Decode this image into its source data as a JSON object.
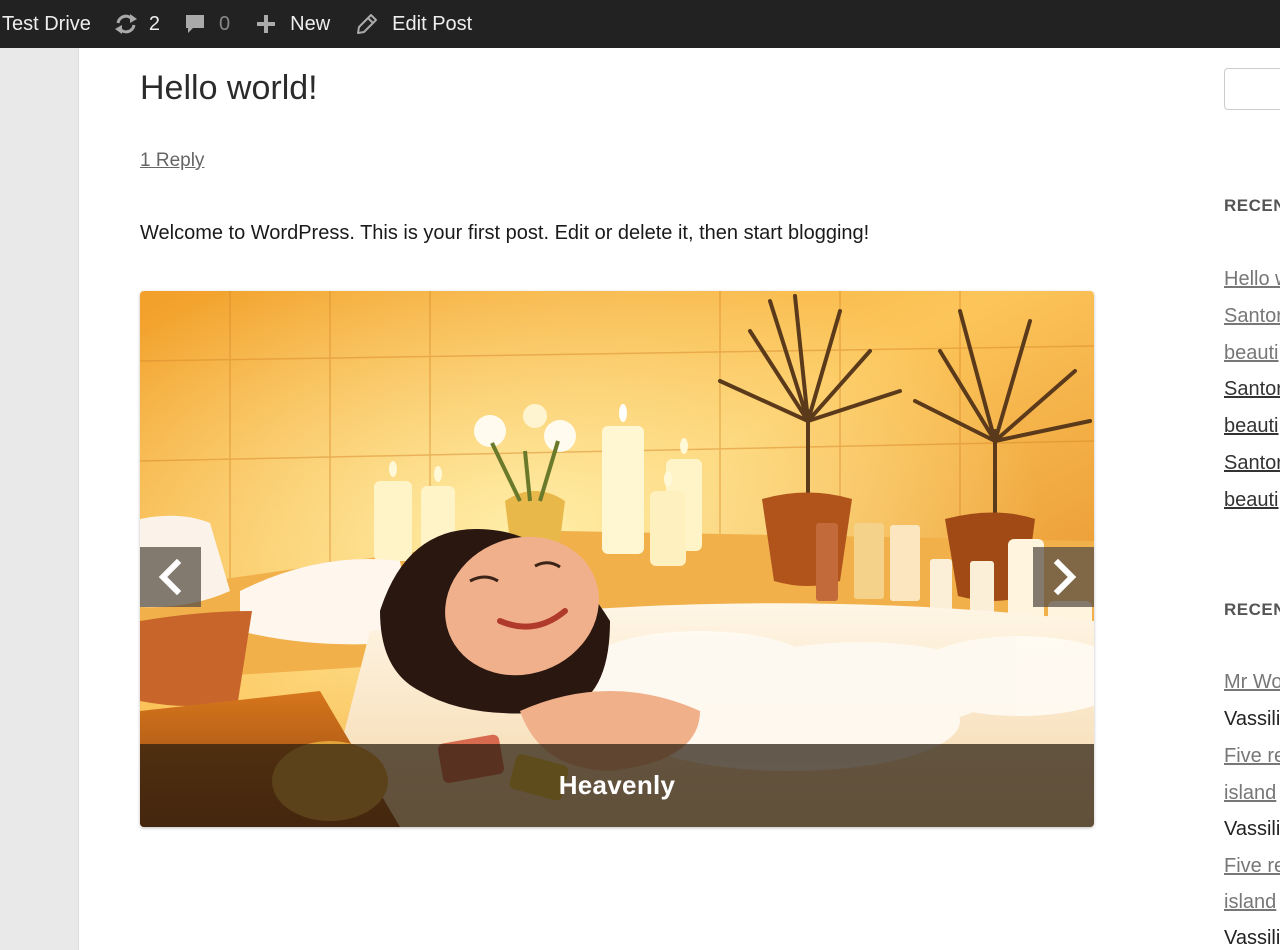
{
  "adminbar": {
    "site_name": "Test Drive",
    "updates_count": "2",
    "comments_count": "0",
    "new_label": "New",
    "edit_label": "Edit Post",
    "icons": {
      "updates": "refresh-icon",
      "comments": "speech-bubble-icon",
      "new": "plus-icon",
      "edit": "pencil-icon"
    }
  },
  "post": {
    "title": "Hello world!",
    "reply_link": "1 Reply",
    "body": "Welcome to WordPress. This is your first post. Edit or delete it, then start blogging!"
  },
  "slider": {
    "caption": "Heavenly",
    "image_subject": "woman relaxing in a candle-lit bubble bath"
  },
  "sidebar": {
    "recent_posts_title": "RECENT",
    "recent_posts": [
      "Hello w",
      "Santor",
      "beauti",
      "Santor",
      "beauti",
      "Santor",
      "beauti"
    ],
    "recent_comments_title": "RECENT",
    "recent_comments": [
      "Mr Wo",
      "Vassili",
      "Five re",
      "island",
      "Vassili",
      "Five re",
      "island",
      "Vassili"
    ]
  },
  "colors": {
    "adminbar_bg": "#222222",
    "gutter_bg": "#e9e9e9",
    "caption_overlay": "#281c0e"
  }
}
